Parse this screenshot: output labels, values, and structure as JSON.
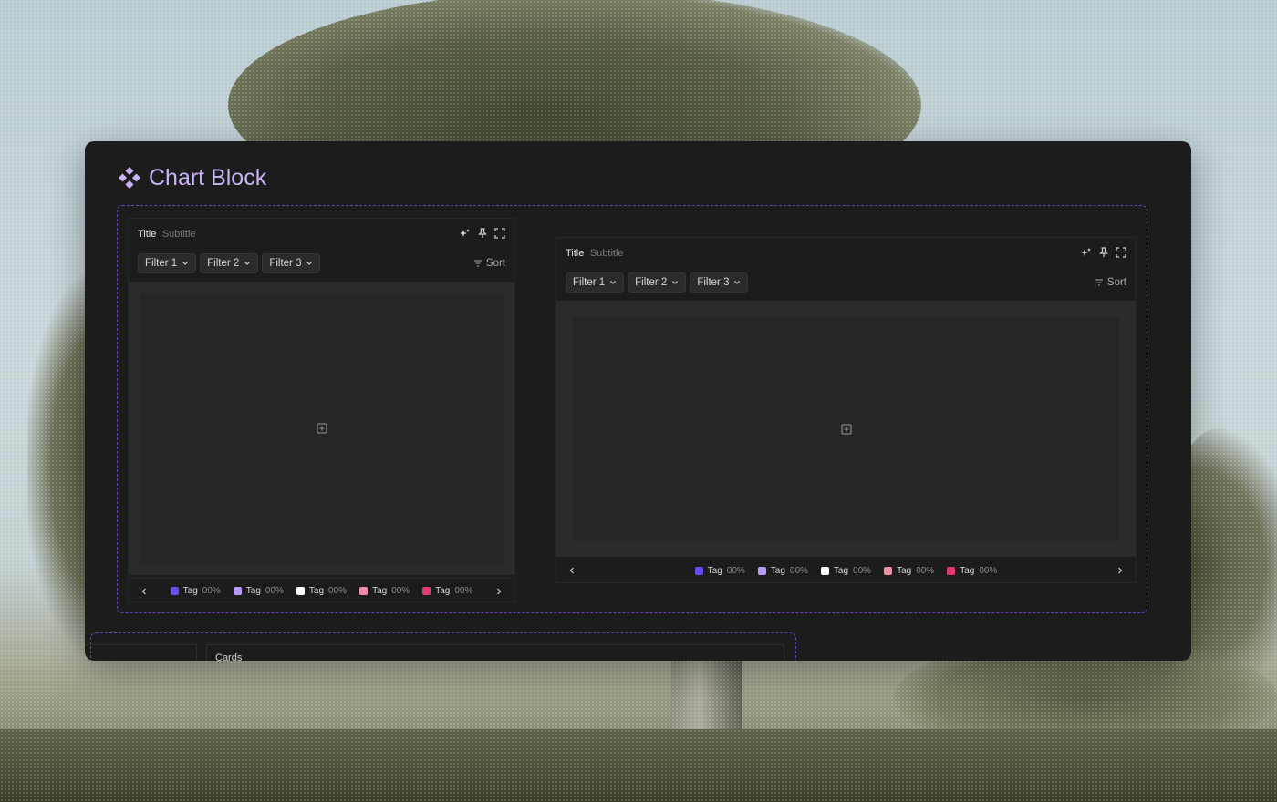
{
  "window": {
    "title": "Chart Block",
    "accent": "#c9b3f5",
    "frame_color": "#6a3fc1"
  },
  "panels": [
    {
      "title": "Title",
      "subtitle": "Subtitle",
      "tools": [
        "sparkle-icon",
        "pin-icon",
        "fullscreen-icon"
      ],
      "filters": [
        "Filter 1",
        "Filter 2",
        "Filter 3"
      ],
      "sort_label": "Sort",
      "legend": [
        {
          "label": "Tag",
          "value": "00%",
          "color": "#6c4cf1"
        },
        {
          "label": "Tag",
          "value": "00%",
          "color": "#b49cf7"
        },
        {
          "label": "Tag",
          "value": "00%",
          "color": "#ffffff"
        },
        {
          "label": "Tag",
          "value": "00%",
          "color": "#f08aa5"
        },
        {
          "label": "Tag",
          "value": "00%",
          "color": "#e03a72"
        }
      ]
    },
    {
      "title": "Title",
      "subtitle": "Subtitle",
      "tools": [
        "sparkle-icon",
        "pin-icon",
        "fullscreen-icon"
      ],
      "filters": [
        "Filter 1",
        "Filter 2",
        "Filter 3"
      ],
      "sort_label": "Sort",
      "legend": [
        {
          "label": "Tag",
          "value": "00%",
          "color": "#6c4cf1"
        },
        {
          "label": "Tag",
          "value": "00%",
          "color": "#b49cf7"
        },
        {
          "label": "Tag",
          "value": "00%",
          "color": "#ffffff"
        },
        {
          "label": "Tag",
          "value": "00%",
          "color": "#f08aa5"
        },
        {
          "label": "Tag",
          "value": "00%",
          "color": "#e03a72"
        }
      ]
    }
  ],
  "cards": {
    "label": "Cards"
  }
}
